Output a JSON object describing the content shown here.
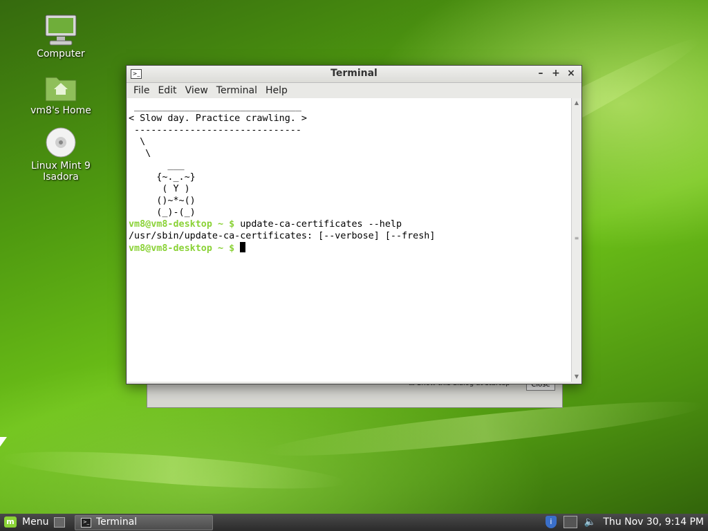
{
  "desktop": {
    "icons": [
      {
        "label": "Computer",
        "icon": "computer-icon"
      },
      {
        "label": "vm8's Home",
        "icon": "home-folder-icon"
      },
      {
        "label": "Linux Mint 9 Isadora",
        "icon": "disc-icon"
      }
    ]
  },
  "background_dialog": {
    "checkbox_label": "Show this dialog at startup",
    "close_label": "Close"
  },
  "terminal": {
    "title": "Terminal",
    "menu": [
      "File",
      "Edit",
      "View",
      "Terminal",
      "Help"
    ],
    "cowsay": [
      " ______________________________",
      "< Slow day. Practice crawling. >",
      " ------------------------------",
      "  \\",
      "   \\",
      "       ___",
      "     {~._.~}",
      "      ( Y )",
      "     ()~*~()",
      "     (_)-(_)"
    ],
    "prompt": "vm8@vm8-desktop ~ $",
    "command": "update-ca-certificates --help",
    "output": "/usr/sbin/update-ca-certificates: [--verbose] [--fresh]"
  },
  "panel": {
    "menu_label": "Menu",
    "task_label": "Terminal",
    "clock": "Thu Nov 30,  9:14 PM"
  }
}
